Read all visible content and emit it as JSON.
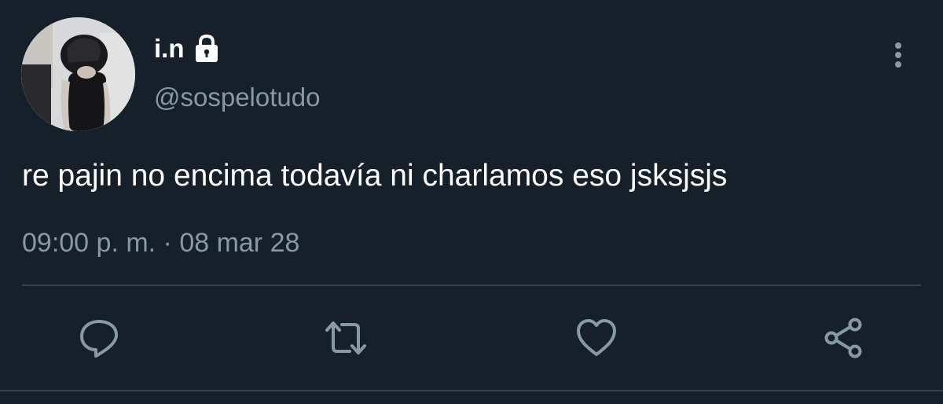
{
  "user": {
    "display_name": "i.n",
    "handle": "@sospelotudo",
    "protected": true,
    "avatar": "profile-photo"
  },
  "tweet": {
    "text": "re pajin no encima todavía ni charlamos eso jsksjsjs",
    "timestamp": "09:00 p. m. · 08 mar 28"
  },
  "actions": {
    "reply_icon": "reply-icon",
    "retweet_icon": "retweet-icon",
    "like_icon": "heart-icon",
    "share_icon": "share-icon",
    "more_icon": "more-vertical-icon"
  },
  "colors": {
    "background": "#15202b",
    "primary_text": "#ffffff",
    "secondary_text": "#8899a6",
    "divider": "#38444d"
  }
}
